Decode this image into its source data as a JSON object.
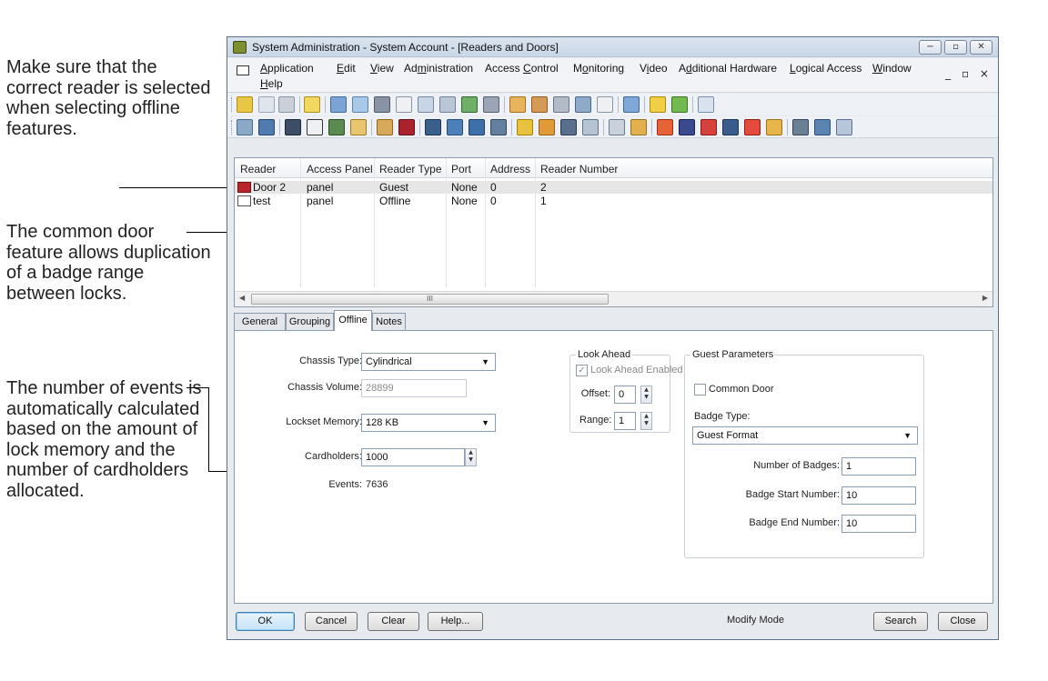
{
  "callouts": {
    "reader": "Make sure that the correct reader is selected when selecting offline features.",
    "common_door": "The common door feature allows duplication of a badge range between locks.",
    "events": "The number of events is automatically calculated based on the amount of lock memory and the number of cardholders allocated."
  },
  "window": {
    "title": "System Administration - System Account - [Readers and Doors]",
    "controls": {
      "minimize": "−",
      "maximize": "▫",
      "close": "✕"
    },
    "mdi_controls": "_ ▫ ×"
  },
  "menu": {
    "items": [
      {
        "pre": "",
        "u": "A",
        "post": "pplication"
      },
      {
        "pre": "",
        "u": "E",
        "post": "dit"
      },
      {
        "pre": "",
        "u": "V",
        "post": "iew"
      },
      {
        "pre": "Ad",
        "u": "m",
        "post": "inistration"
      },
      {
        "pre": "Access ",
        "u": "C",
        "post": "ontrol"
      },
      {
        "pre": "M",
        "u": "o",
        "post": "nitoring"
      },
      {
        "pre": "V",
        "u": "i",
        "post": "deo"
      },
      {
        "pre": "A",
        "u": "d",
        "post": "ditional Hardware"
      },
      {
        "pre": "",
        "u": "L",
        "post": "ogical Access"
      },
      {
        "pre": "",
        "u": "W",
        "post": "indow"
      },
      {
        "pre": "",
        "u": "H",
        "post": "elp"
      }
    ]
  },
  "grid": {
    "columns": [
      "Reader",
      "Access Panel",
      "Reader Type",
      "Port",
      "Address",
      "Reader Number"
    ],
    "rows": [
      {
        "reader": "Door 2",
        "panel": "panel",
        "type": "Guest",
        "port": "None",
        "address": "0",
        "number": "2"
      },
      {
        "reader": "test",
        "panel": "panel",
        "type": "Offline",
        "port": "None",
        "address": "0",
        "number": "1"
      }
    ],
    "scroll_thumb_label": "III"
  },
  "tabs": [
    "General",
    "Grouping",
    "Offline",
    "Notes"
  ],
  "offline": {
    "chassis_type_label": "Chassis Type:",
    "chassis_type_value": "Cylindrical",
    "chassis_volume_label": "Chassis Volume:",
    "chassis_volume_value": "28899",
    "lockset_memory_label": "Lockset Memory:",
    "lockset_memory_value": "128 KB",
    "cardholders_label": "Cardholders:",
    "cardholders_value": "1000",
    "events_label": "Events:",
    "events_value": "7636",
    "look_ahead": {
      "title": "Look Ahead",
      "enabled_label": "Look Ahead Enabled",
      "offset_label": "Offset:",
      "offset_value": "0",
      "range_label": "Range:",
      "range_value": "1"
    },
    "guest": {
      "title": "Guest Parameters",
      "common_door_label": "Common Door",
      "badge_type_label": "Badge Type:",
      "badge_type_value": "Guest Format",
      "num_badges_label": "Number of Badges:",
      "num_badges_value": "1",
      "badge_start_label": "Badge Start Number:",
      "badge_start_value": "10",
      "badge_end_label": "Badge End Number:",
      "badge_end_value": "10"
    }
  },
  "buttons": {
    "ok": "OK",
    "cancel": "Cancel",
    "clear": "Clear",
    "help": "Help...",
    "search": "Search",
    "close": "Close"
  },
  "status": "Modify Mode",
  "colors": {
    "accent_red": "#b9262a",
    "selection_row": "#e6e6e6",
    "default_button": "#3c7fb1"
  }
}
